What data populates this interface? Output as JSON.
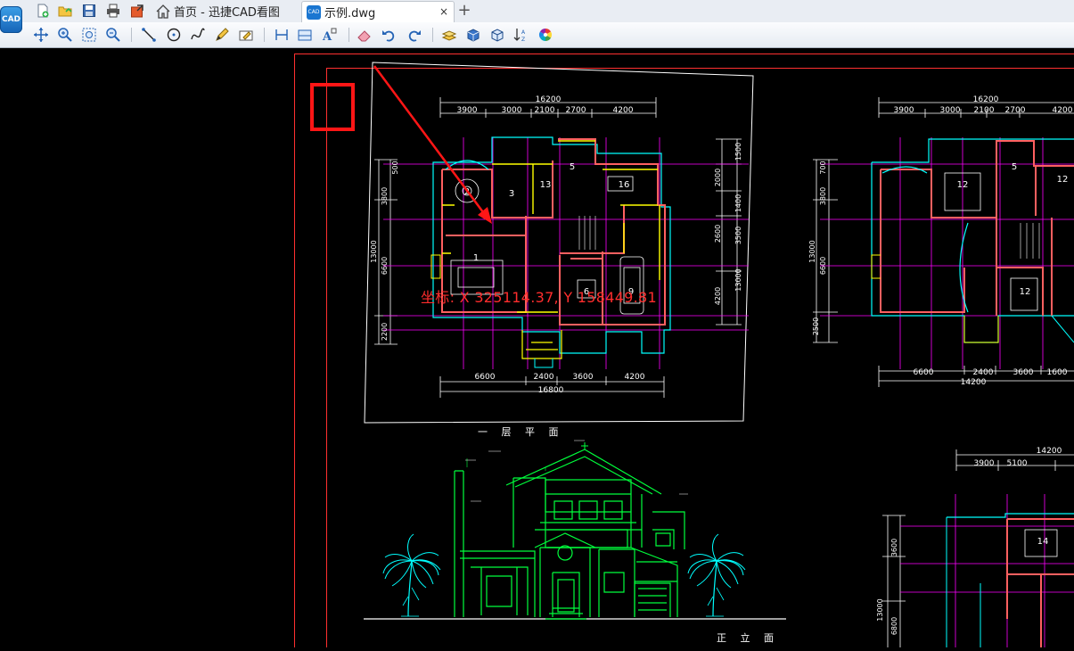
{
  "app": {
    "logo_text": "CAD"
  },
  "tabs": [
    {
      "label": "首页 - 迅捷CAD看图",
      "active": false
    },
    {
      "label": "示例.dwg",
      "active": true
    }
  ],
  "tab_close_glyph": "×",
  "tab_add_glyph": "+",
  "drawing": {
    "coordinate_readout": "坐标: X 325114.37, Y 158449.81",
    "floor_plan_title": "一 层 平 面",
    "elevation_title": "正 立 面",
    "dims_top_total": "16200",
    "dims_top": [
      "3900",
      "3000",
      "2100",
      "2700",
      "4200"
    ],
    "dims_bottom_total": "16800",
    "dims_bottom": [
      "6600",
      "2400",
      "3600",
      "4200"
    ],
    "dims_left": [
      "13000",
      "3800",
      "6600",
      "2200",
      "500"
    ],
    "dims_right": [
      "1500",
      "2000",
      "1400",
      "2600",
      "3500",
      "13000",
      "4200"
    ],
    "plan2_top_total": "16200",
    "plan2_top": [
      "3900",
      "3000",
      "2100",
      "2700",
      "4200"
    ],
    "plan2_bottom_total": "14200",
    "plan2_bottom": [
      "6600",
      "2400",
      "3600",
      "1600"
    ],
    "plan2_left": [
      "13000",
      "3800",
      "6600",
      "2500",
      "700"
    ],
    "plan3_top_total": "14200",
    "plan3_top": [
      "3900",
      "5100"
    ],
    "plan3_left": [
      "13000",
      "3600",
      "6800"
    ],
    "room_numbers": [
      "2",
      "3",
      "13",
      "5",
      "16",
      "1",
      "6",
      "9"
    ],
    "room_numbers_plan2": [
      "12",
      "5",
      "12",
      "12"
    ],
    "room_number_plan3": "14"
  },
  "colors": {
    "accent_highlight": "#ff1616",
    "coordinate_text": "#ff2d2d",
    "cad_white": "#ffffff",
    "cad_cyan": "#00ffff",
    "cad_green": "#00ff3c",
    "cad_magenta": "#ff00ff",
    "cad_red": "#ff3030",
    "cad_yellow": "#ffff00"
  }
}
